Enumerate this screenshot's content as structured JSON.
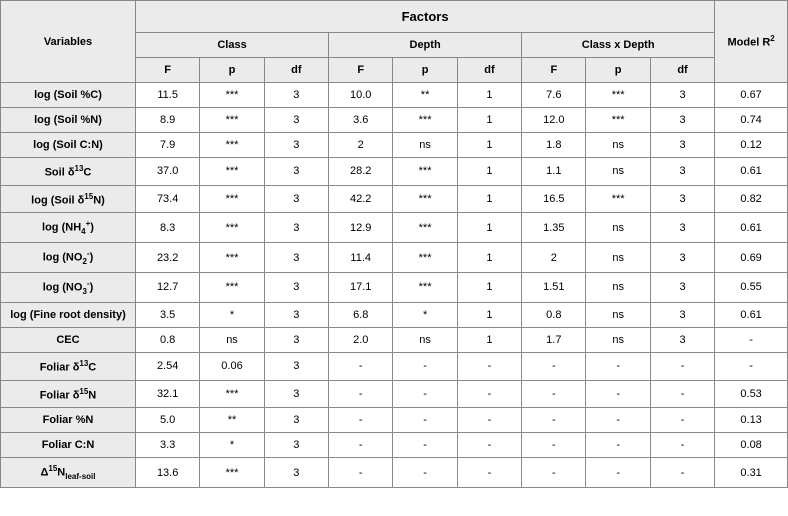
{
  "headers": {
    "variables": "Variables",
    "factors": "Factors",
    "class": "Class",
    "depth": "Depth",
    "class_x_depth": "Class x Depth",
    "model_r2_a": "Model R",
    "model_r2_b": "2",
    "F": "F",
    "p": "p",
    "df": "df"
  },
  "chart_data": {
    "type": "table",
    "columns": [
      "Variable",
      "Class F",
      "Class p",
      "Class df",
      "Depth F",
      "Depth p",
      "Depth df",
      "Class×Depth F",
      "Class×Depth p",
      "Class×Depth df",
      "Model R²"
    ],
    "rows": [
      [
        "log (Soil %C)",
        11.5,
        "***",
        3,
        10.0,
        "**",
        1,
        7.6,
        "***",
        3,
        0.67
      ],
      [
        "log (Soil %N)",
        8.9,
        "***",
        3,
        3.6,
        "***",
        1,
        12.0,
        "***",
        3,
        0.74
      ],
      [
        "log (Soil C:N)",
        7.9,
        "***",
        3,
        2,
        "ns",
        1,
        1.8,
        "ns",
        3,
        0.12
      ],
      [
        "Soil δ13C",
        37.0,
        "***",
        3,
        28.2,
        "***",
        1,
        1.1,
        "ns",
        3,
        0.61
      ],
      [
        "log (Soil δ15N)",
        73.4,
        "***",
        3,
        42.2,
        "***",
        1,
        16.5,
        "***",
        3,
        0.82
      ],
      [
        "log (NH4+)",
        8.3,
        "***",
        3,
        12.9,
        "***",
        1,
        1.35,
        "ns",
        3,
        0.61
      ],
      [
        "log (NO2-)",
        23.2,
        "***",
        3,
        11.4,
        "***",
        1,
        2,
        "ns",
        3,
        0.69
      ],
      [
        "log (NO3-)",
        12.7,
        "***",
        3,
        17.1,
        "***",
        1,
        1.51,
        "ns",
        3,
        0.55
      ],
      [
        "log (Fine root density)",
        3.5,
        "*",
        3,
        6.8,
        "*",
        1,
        0.8,
        "ns",
        3,
        0.61
      ],
      [
        "CEC",
        0.8,
        "ns",
        3,
        2.0,
        "ns",
        1,
        1.7,
        "ns",
        3,
        "-"
      ],
      [
        "Foliar δ13C",
        2.54,
        "0.06",
        3,
        "-",
        "-",
        "-",
        "-",
        "-",
        "-",
        "-"
      ],
      [
        "Foliar δ15N",
        32.1,
        "***",
        3,
        "-",
        "-",
        "-",
        "-",
        "-",
        "-",
        0.53
      ],
      [
        "Foliar %N",
        5.0,
        "**",
        3,
        "-",
        "-",
        "-",
        "-",
        "-",
        "-",
        0.13
      ],
      [
        "Foliar C:N",
        3.3,
        "*",
        3,
        "-",
        "-",
        "-",
        "-",
        "-",
        "-",
        0.08
      ],
      [
        "Δ15N leaf-soil",
        13.6,
        "***",
        3,
        "-",
        "-",
        "-",
        "-",
        "-",
        "-",
        0.31
      ]
    ]
  },
  "rows": [
    {
      "var_html": "log (Soil %C)",
      "cF": "11.5",
      "cp": "***",
      "cdf": "3",
      "dF": "10.0",
      "dp": "**",
      "ddf": "1",
      "xF": "7.6",
      "xp": "***",
      "xdf": "3",
      "r2": "0.67"
    },
    {
      "var_html": "log (Soil %N)",
      "cF": "8.9",
      "cp": "***",
      "cdf": "3",
      "dF": "3.6",
      "dp": "***",
      "ddf": "1",
      "xF": "12.0",
      "xp": "***",
      "xdf": "3",
      "r2": "0.74"
    },
    {
      "var_html": "log (Soil C:N)",
      "cF": "7.9",
      "cp": "***",
      "cdf": "3",
      "dF": "2",
      "dp": "ns",
      "ddf": "1",
      "xF": "1.8",
      "xp": "ns",
      "xdf": "3",
      "r2": "0.12"
    },
    {
      "var_html": "Soil δ<span class=\"sup\">13</span>C",
      "cF": "37.0",
      "cp": "***",
      "cdf": "3",
      "dF": "28.2",
      "dp": "***",
      "ddf": "1",
      "xF": "1.1",
      "xp": "ns",
      "xdf": "3",
      "r2": "0.61"
    },
    {
      "var_html": "log (Soil δ<span class=\"sup\">15</span>N)",
      "cF": "73.4",
      "cp": "***",
      "cdf": "3",
      "dF": "42.2",
      "dp": "***",
      "ddf": "1",
      "xF": "16.5",
      "xp": "***",
      "xdf": "3",
      "r2": "0.82"
    },
    {
      "var_html": "log (NH<span class=\"sub\">4</span><span class=\"sup\">+</span>)",
      "cF": "8.3",
      "cp": "***",
      "cdf": "3",
      "dF": "12.9",
      "dp": "***",
      "ddf": "1",
      "xF": "1.35",
      "xp": "ns",
      "xdf": "3",
      "r2": "0.61"
    },
    {
      "var_html": "log (NO<span class=\"sub\">2</span><span class=\"sup\">-</span>)",
      "cF": "23.2",
      "cp": "***",
      "cdf": "3",
      "dF": "11.4",
      "dp": "***",
      "ddf": "1",
      "xF": "2",
      "xp": "ns",
      "xdf": "3",
      "r2": "0.69"
    },
    {
      "var_html": "log (NO<span class=\"sub\">3</span><span class=\"sup\">-</span>)",
      "cF": "12.7",
      "cp": "***",
      "cdf": "3",
      "dF": "17.1",
      "dp": "***",
      "ddf": "1",
      "xF": "1.51",
      "xp": "ns",
      "xdf": "3",
      "r2": "0.55"
    },
    {
      "var_html": "log (Fine root density)",
      "cF": "3.5",
      "cp": "*",
      "cdf": "3",
      "dF": "6.8",
      "dp": "*",
      "ddf": "1",
      "xF": "0.8",
      "xp": "ns",
      "xdf": "3",
      "r2": "0.61"
    },
    {
      "var_html": "CEC",
      "cF": "0.8",
      "cp": "ns",
      "cdf": "3",
      "dF": "2.0",
      "dp": "ns",
      "ddf": "1",
      "xF": "1.7",
      "xp": "ns",
      "xdf": "3",
      "r2": "-"
    },
    {
      "var_html": "Foliar δ<span class=\"sup\">13</span>C",
      "cF": "2.54",
      "cp": "0.06",
      "cdf": "3",
      "dF": "-",
      "dp": "-",
      "ddf": "-",
      "xF": "-",
      "xp": "-",
      "xdf": "-",
      "r2": "-"
    },
    {
      "var_html": "Foliar δ<span class=\"sup\">15</span>N",
      "cF": "32.1",
      "cp": "***",
      "cdf": "3",
      "dF": "-",
      "dp": "-",
      "ddf": "-",
      "xF": "-",
      "xp": "-",
      "xdf": "-",
      "r2": "0.53"
    },
    {
      "var_html": "Foliar %N",
      "cF": "5.0",
      "cp": "**",
      "cdf": "3",
      "dF": "-",
      "dp": "-",
      "ddf": "-",
      "xF": "-",
      "xp": "-",
      "xdf": "-",
      "r2": "0.13"
    },
    {
      "var_html": "Foliar C:N",
      "cF": "3.3",
      "cp": "*",
      "cdf": "3",
      "dF": "-",
      "dp": "-",
      "ddf": "-",
      "xF": "-",
      "xp": "-",
      "xdf": "-",
      "r2": "0.08"
    },
    {
      "var_html": "Δ<span class=\"sup\">15</span>N<span class=\"sub\">leaf-soil</span>",
      "cF": "13.6",
      "cp": "***",
      "cdf": "3",
      "dF": "-",
      "dp": "-",
      "ddf": "-",
      "xF": "-",
      "xp": "-",
      "xdf": "-",
      "r2": "0.31"
    }
  ]
}
